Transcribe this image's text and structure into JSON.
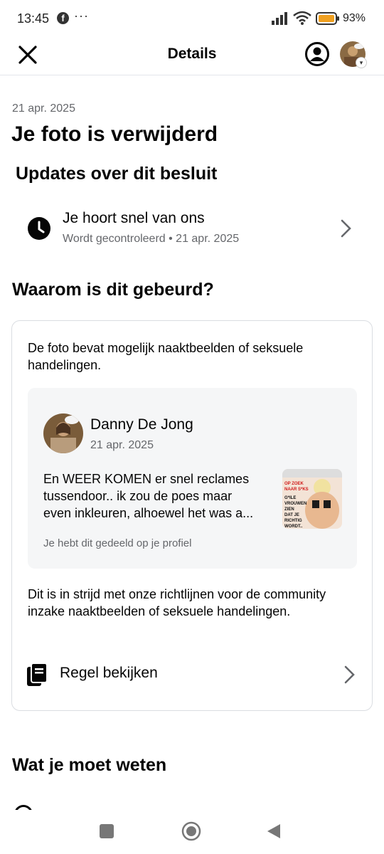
{
  "status_bar": {
    "time": "13:45",
    "dots": "···",
    "battery": "93%"
  },
  "header": {
    "title": "Details"
  },
  "date": "21 apr. 2025",
  "title": "Je foto is verwijderd",
  "updates": {
    "heading": "Updates over dit besluit",
    "item_title": "Je hoort snel van ons",
    "item_subtitle": "Wordt gecontroleerd • 21 apr. 2025"
  },
  "why": {
    "heading": "Waarom is dit gebeurd?",
    "intro": "De foto bevat mogelijk naaktbeelden of seksuele handelingen.",
    "post": {
      "author": "Danny De Jong",
      "date": "21 apr. 2025",
      "text_lines": [
        "En WEER KOMEN er snel reclames",
        "tussendoor.. ik zou de poes maar",
        "even inkleuren, alhoewel het was a..."
      ],
      "shared_note": "Je hebt dit gedeeld op je profiel",
      "thumb_text": [
        "OP ZOEK",
        "NAAR S*KS",
        "G*ILE",
        "VROUWEN",
        "ZIEN",
        "DAT JE",
        "RICHTIG",
        "WORDT.."
      ]
    },
    "policy": "Dit is in strijd met onze richtlijnen voor de community inzake naaktbeelden of seksuele handelingen.",
    "rule_label": "Regel bekijken"
  },
  "know": {
    "heading": "Wat je moet weten"
  }
}
